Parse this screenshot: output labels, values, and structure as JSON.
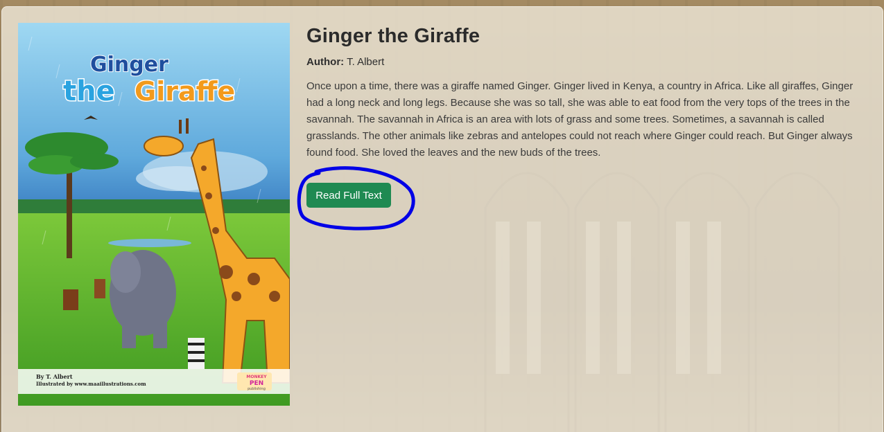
{
  "book": {
    "title": "Ginger the Giraffe",
    "author_label": "Author:",
    "author_name": "T. Albert",
    "description": "Once upon a time, there was a giraffe named Ginger. Ginger lived in Kenya, a country in Africa. Like all giraffes, Ginger had a long neck and long legs. Because she was so tall, she was able to eat food from the very tops of the trees in the savannah. The savannah in Africa is an area with lots of grass and some trees. Sometimes, a savannah is called grasslands. The other animals like zebras and antelopes could not reach where Ginger could reach. But Ginger always found food. She loved the leaves and the new buds of the trees.",
    "read_button_label": "Read Full Text"
  },
  "cover": {
    "title_line1": "Ginger",
    "title_line2_a": "the",
    "title_line2_b": "Giraffe",
    "by_line": "By T. Albert",
    "illustrated_line": "Illustrated by www.maaillustrations.com",
    "publisher_top": "MONKEY",
    "publisher_mid": "PEN",
    "publisher_bottom": "publishing"
  },
  "colors": {
    "button": "#1f8a52",
    "annotation_circle": "#0000e6",
    "card_background": "#efe8da"
  },
  "icons": {
    "annotation": "hand-drawn-circle"
  }
}
